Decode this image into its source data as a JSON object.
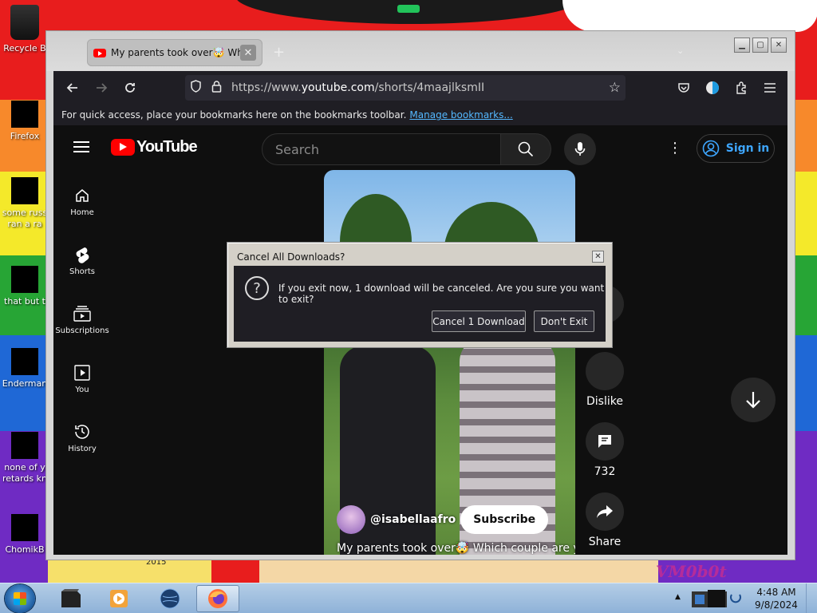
{
  "desktop": {
    "icons": [
      {
        "label": "Recycle B"
      },
      {
        "label": "Firefox"
      },
      {
        "label": "some russ ran a ra"
      },
      {
        "label": "that but t"
      },
      {
        "label": "Enderman"
      },
      {
        "label": "none of y retards kn"
      },
      {
        "label": "ChomikB"
      }
    ],
    "year_text": "2015",
    "watermark": "VM0b0t"
  },
  "browser": {
    "tab_title": "My parents took over🤯 Which",
    "url_prefix": "https://www.",
    "url_domain": "youtube.com",
    "url_path": "/shorts/4maajlksmII",
    "bookmarks_message": "For quick access, place your bookmarks here on the bookmarks toolbar.",
    "bookmarks_link": "Manage bookmarks..."
  },
  "youtube": {
    "logo_text": "YouTube",
    "search_placeholder": "Search",
    "sign_in": "Sign in",
    "sidebar": [
      {
        "label": "Home"
      },
      {
        "label": "Shorts"
      },
      {
        "label": "Subscriptions"
      },
      {
        "label": "You"
      },
      {
        "label": "History"
      }
    ],
    "short": {
      "channel": "@isabellaafro",
      "subscribe": "Subscribe",
      "title": "My parents took over🤯 Which couple are you"
    },
    "actions": {
      "dislike": "Dislike",
      "comments": "732",
      "share": "Share"
    }
  },
  "dialog": {
    "title": "Cancel All Downloads?",
    "message": "If you exit now, 1 download will be canceled. Are you sure you want to exit?",
    "confirm": "Cancel 1 Download",
    "cancel": "Don't Exit"
  },
  "taskbar": {
    "time": "4:48 AM",
    "date": "9/8/2024"
  },
  "colors": {
    "accent_link": "#54b8ff",
    "youtube_red": "#ff0000",
    "signin_blue": "#3ea6ff"
  }
}
